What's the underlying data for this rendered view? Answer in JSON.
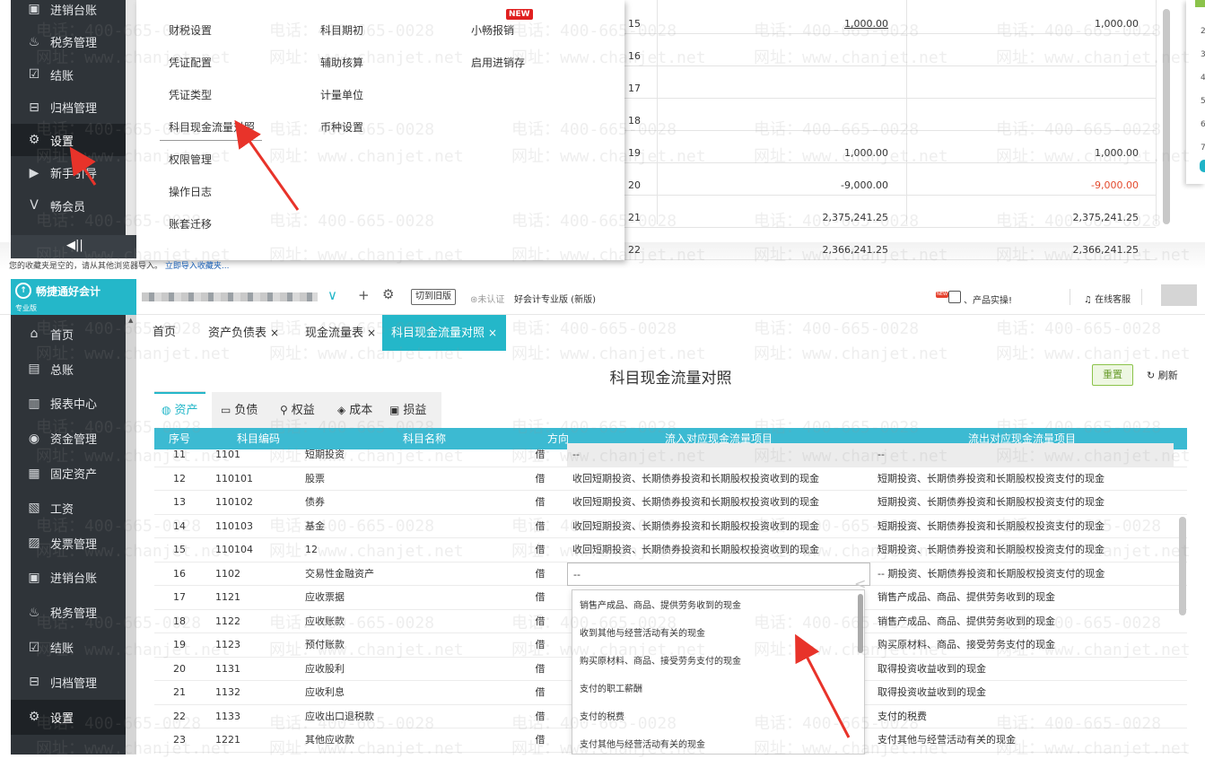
{
  "top_screenshot": {
    "sidebar": {
      "items": [
        {
          "icon": "ledger-icon",
          "label": "进销台账",
          "active": false
        },
        {
          "icon": "tax-icon",
          "label": "税务管理",
          "active": false
        },
        {
          "icon": "checkout-icon",
          "label": "结账",
          "active": false
        },
        {
          "icon": "archive-icon",
          "label": "归档管理",
          "active": false
        },
        {
          "icon": "gear-icon",
          "label": "设置",
          "active": true
        },
        {
          "icon": "guide-icon",
          "label": "新手引导",
          "active": false
        },
        {
          "icon": "vip-icon",
          "label": "畅会员",
          "active": false
        }
      ]
    },
    "settings_menu": {
      "col1": [
        "财税设置",
        "凭证配置",
        "凭证类型",
        "科目现金流量对照",
        "权限管理",
        "操作日志",
        "账套迁移"
      ],
      "col2": [
        "科目期初",
        "辅助核算",
        "计量单位",
        "币种设置"
      ],
      "col3": [
        "小畅报销",
        "启用进销存"
      ],
      "new_badge": "NEW"
    },
    "background_table": {
      "rows": [
        {
          "no": "15",
          "mid": "1,000.00",
          "right": "1,000.00",
          "mid_underline": true,
          "right_red": false
        },
        {
          "no": "16",
          "mid": "",
          "right": "",
          "mid_underline": false,
          "right_red": false
        },
        {
          "no": "17",
          "mid": "",
          "right": "",
          "mid_underline": false,
          "right_red": false
        },
        {
          "no": "18",
          "mid": "",
          "right": "",
          "mid_underline": false,
          "right_red": false
        },
        {
          "no": "19",
          "mid": "1,000.00",
          "right": "1,000.00",
          "mid_underline": false,
          "right_red": false
        },
        {
          "no": "20",
          "mid": "-9,000.00",
          "right": "-9,000.00",
          "mid_underline": false,
          "right_red": true
        },
        {
          "no": "21",
          "mid": "2,375,241.25",
          "right": "2,375,241.25",
          "mid_underline": false,
          "right_red": false
        },
        {
          "no": "22",
          "mid": "2,366,241.25",
          "right": "2,366,241.25",
          "mid_underline": false,
          "right_red": false
        }
      ]
    },
    "right_panel_numbers": [
      "2",
      "3",
      "4",
      "5",
      "6",
      "7"
    ],
    "collect_tip": {
      "text": "您的收藏夹是空的，请从其他浏览器导入。",
      "link": "立即导入收藏夹..."
    }
  },
  "bottom_screenshot": {
    "header": {
      "logo_title": "畅捷通好会计",
      "logo_sub": "专业版",
      "switch_old_label": "切到旧版",
      "cert_label": "未认证",
      "edition_label": "好会计专业版 (新版)",
      "product_label": "、产品实操!",
      "service_label": "在线客服",
      "new_label": "NEW"
    },
    "sidebar": {
      "items": [
        {
          "icon": "home-icon",
          "label": "首页"
        },
        {
          "icon": "ledger-book-icon",
          "label": "总账"
        },
        {
          "icon": "report-icon",
          "label": "报表中心"
        },
        {
          "icon": "fund-icon",
          "label": "资金管理"
        },
        {
          "icon": "asset-icon",
          "label": "固定资产"
        },
        {
          "icon": "salary-icon",
          "label": "工资"
        },
        {
          "icon": "invoice-icon",
          "label": "发票管理"
        },
        {
          "icon": "ledger-icon",
          "label": "进销台账"
        },
        {
          "icon": "tax-icon",
          "label": "税务管理"
        },
        {
          "icon": "checkout-icon",
          "label": "结账"
        },
        {
          "icon": "archive-icon",
          "label": "归档管理"
        },
        {
          "icon": "gear-icon",
          "label": "设置"
        }
      ]
    },
    "tabs": [
      {
        "label": "首页",
        "closable": false,
        "active": false
      },
      {
        "label": "资产负债表",
        "closable": true,
        "active": false
      },
      {
        "label": "现金流量表",
        "closable": true,
        "active": false
      },
      {
        "label": "科目现金流量对照",
        "closable": true,
        "active": true
      }
    ],
    "page_title": "科目现金流量对照",
    "reset_label": "重置",
    "refresh_label": "刷新",
    "sub_tabs": [
      {
        "icon": "asset-tab-icon",
        "label": "资产",
        "active": true
      },
      {
        "icon": "liability-tab-icon",
        "label": "负债",
        "active": false
      },
      {
        "icon": "equity-tab-icon",
        "label": "权益",
        "active": false
      },
      {
        "icon": "cost-tab-icon",
        "label": "成本",
        "active": false
      },
      {
        "icon": "profit-tab-icon",
        "label": "损益",
        "active": false
      }
    ],
    "table": {
      "columns": [
        "序号",
        "科目编码",
        "科目名称",
        "方向",
        "流入对应现金流量项目",
        "流出对应现金流量项目"
      ],
      "rows": [
        {
          "no": "11",
          "code": "1101",
          "name": "短期投资",
          "dir": "借",
          "inflow": "--",
          "outflow": "--",
          "grey": true
        },
        {
          "no": "12",
          "code": "110101",
          "name": "股票",
          "dir": "借",
          "inflow": "收回短期投资、长期债券投资和长期股权投资收到的现金",
          "outflow": "短期投资、长期债券投资和长期股权投资支付的现金"
        },
        {
          "no": "13",
          "code": "110102",
          "name": "债券",
          "dir": "借",
          "inflow": "收回短期投资、长期债券投资和长期股权投资收到的现金",
          "outflow": "短期投资、长期债券投资和长期股权投资支付的现金"
        },
        {
          "no": "14",
          "code": "110103",
          "name": "基金",
          "dir": "借",
          "inflow": "收回短期投资、长期债券投资和长期股权投资收到的现金",
          "outflow": "短期投资、长期债券投资和长期股权投资支付的现金"
        },
        {
          "no": "15",
          "code": "110104",
          "name": "12",
          "dir": "借",
          "inflow": "收回短期投资、长期债券投资和长期股权投资收到的现金",
          "outflow": "短期投资、长期债券投资和长期股权投资支付的现金"
        },
        {
          "no": "16",
          "code": "1102",
          "name": "交易性金融资产",
          "dir": "借",
          "inflow": "--",
          "outflow": "-- 期投资、长期债券投资和长期股权投资支付的现金",
          "editing": true
        },
        {
          "no": "17",
          "code": "1121",
          "name": "应收票据",
          "dir": "借",
          "inflow": "",
          "outflow": "销售产成品、商品、提供劳务收到的现金"
        },
        {
          "no": "18",
          "code": "1122",
          "name": "应收账款",
          "dir": "借",
          "inflow": "",
          "outflow": "销售产成品、商品、提供劳务收到的现金"
        },
        {
          "no": "19",
          "code": "1123",
          "name": "预付账款",
          "dir": "借",
          "inflow": "",
          "outflow": "购买原材料、商品、接受劳务支付的现金"
        },
        {
          "no": "20",
          "code": "1131",
          "name": "应收股利",
          "dir": "借",
          "inflow": "",
          "outflow": "取得投资收益收到的现金"
        },
        {
          "no": "21",
          "code": "1132",
          "name": "应收利息",
          "dir": "借",
          "inflow": "",
          "outflow": "取得投资收益收到的现金"
        },
        {
          "no": "22",
          "code": "1133",
          "name": "应收出口退税款",
          "dir": "借",
          "inflow": "",
          "outflow": "支付的税费"
        },
        {
          "no": "23",
          "code": "1221",
          "name": "其他应收款",
          "dir": "借",
          "inflow": "",
          "outflow": "支付其他与经营活动有关的现金"
        }
      ]
    },
    "dropdown_options": [
      "销售产成品、商品、提供劳务收到的现金",
      "收到其他与经营活动有关的现金",
      "购买原材料、商品、接受劳务支付的现金",
      "支付的职工薪酬",
      "支付的税费",
      "支付其他与经营活动有关的现金"
    ]
  },
  "watermark": {
    "phone": "电话：400-665-0028",
    "site": "网址：www.chanjet.net"
  },
  "colors": {
    "accent": "#24b7c9",
    "sidebar_bg": "#2f3439",
    "red_arrow": "#e8332a"
  }
}
